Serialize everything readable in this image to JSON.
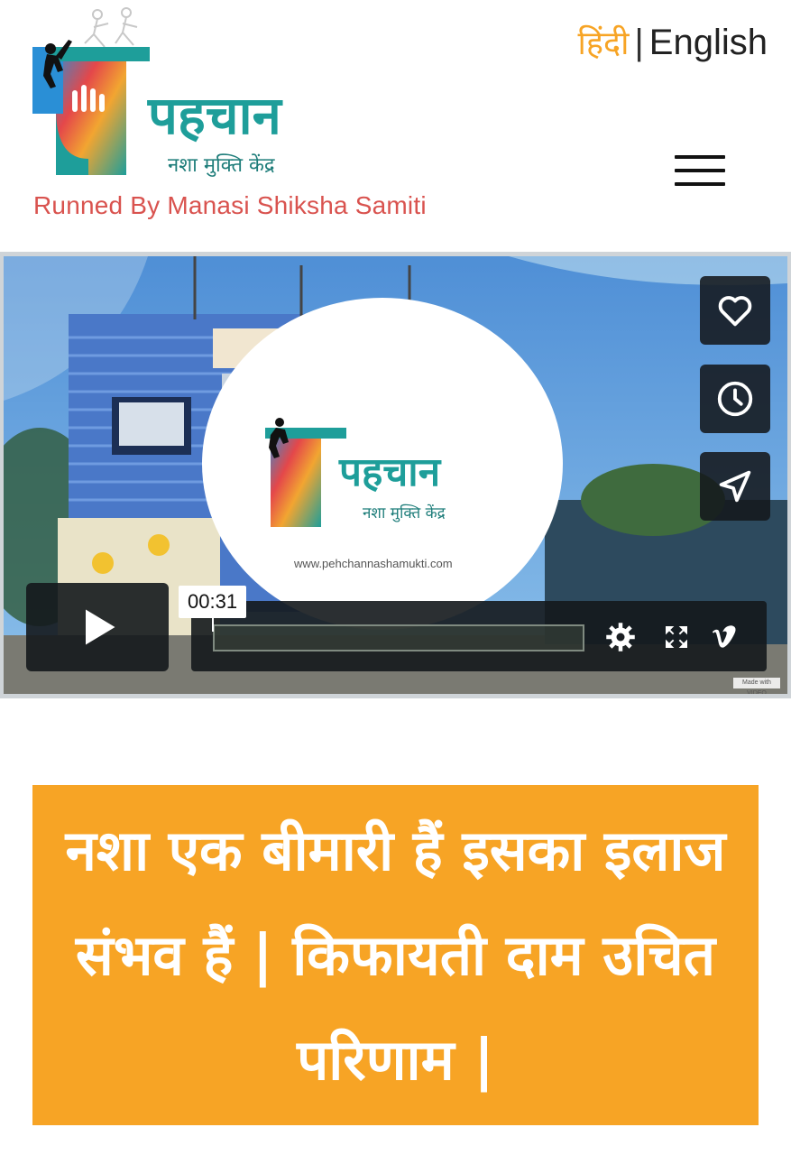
{
  "header": {
    "logo": {
      "brand": "पहचान",
      "sub": "नशा मुक्ति केंद्र",
      "tagline": "Runned By Manasi Shiksha Samiti"
    },
    "lang": {
      "hindi": "हिंदी",
      "separator": "|",
      "english": "English"
    },
    "menu_icon": "hamburger-icon"
  },
  "video": {
    "overlay_logo": {
      "brand": "पहचान",
      "sub": "नशा मुक्ति केंद्र",
      "url": "www.pehchannashamukti.com"
    },
    "side_buttons": [
      "heart-icon",
      "clock-icon",
      "send-icon"
    ],
    "timestamp": "00:31",
    "controls": [
      "play-icon",
      "settings-icon",
      "fullscreen-icon",
      "vimeo-icon"
    ],
    "made_with": "Made with VIDEO"
  },
  "banner": {
    "text": "नशा एक बीमारी हैं इसका इलाज संभव हैं | किफायती दाम उचित परिणाम |",
    "bg": "#f7a425"
  },
  "colors": {
    "brand_teal": "#1e9e9a",
    "accent_orange": "#f7a425",
    "tagline_red": "#d9534f"
  }
}
